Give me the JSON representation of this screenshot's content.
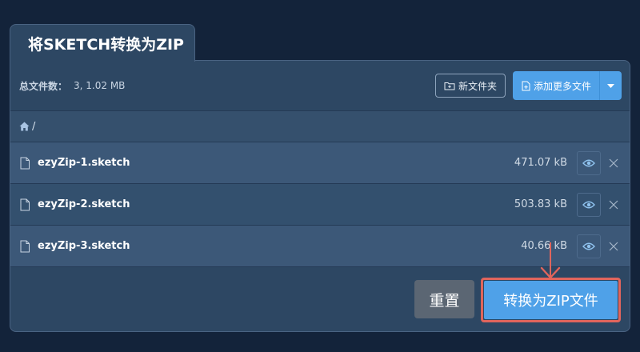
{
  "tab": {
    "title": "将SKETCH转换为ZIP"
  },
  "toolbar": {
    "total_label": "总文件数：",
    "total_value": "3, 1.02 MB",
    "new_folder_label": "新文件夹",
    "add_files_label": "添加更多文件"
  },
  "breadcrumb": {
    "path": "/"
  },
  "files": [
    {
      "name": "ezyZip-1.sketch",
      "size": "471.07 kB"
    },
    {
      "name": "ezyZip-2.sketch",
      "size": "503.83 kB"
    },
    {
      "name": "ezyZip-3.sketch",
      "size": "40.66 kB"
    }
  ],
  "actions": {
    "reset_label": "重置",
    "convert_label": "转换为ZIP文件"
  },
  "colors": {
    "background": "#13233a",
    "panel": "#2d4763",
    "primary": "#4fa1e8",
    "reset": "#5b6673",
    "highlight": "#e0655c"
  },
  "icons": [
    "folder-plus-icon",
    "file-plus-icon",
    "caret-down-icon",
    "home-icon",
    "file-icon",
    "eye-icon",
    "close-icon",
    "arrow-down-icon"
  ]
}
